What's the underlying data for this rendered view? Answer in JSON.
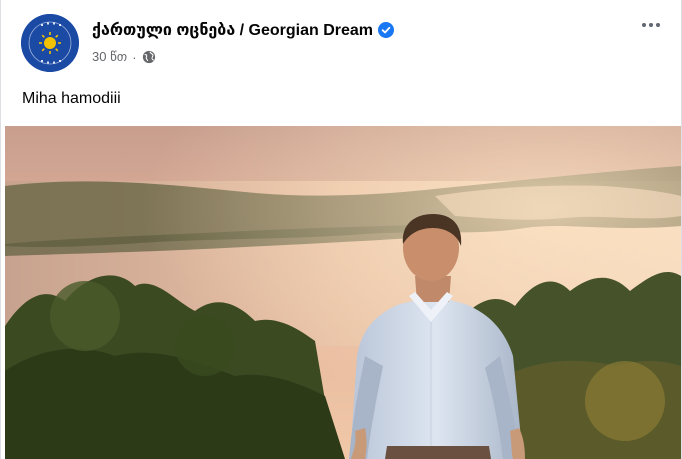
{
  "post": {
    "author": "ქართული ოცნება / Georgian Dream",
    "timestamp": "30 წთ",
    "separator": "·",
    "text": "Miha hamodiii"
  },
  "icons": {
    "avatar": "georgian-dream-logo",
    "verified": "verified-badge-icon",
    "audience": "globe-icon",
    "menu": "more-options-icon"
  },
  "colors": {
    "verified_blue": "#1877f2",
    "logo_blue": "#1b4aa5",
    "logo_gold": "#f2c200"
  }
}
